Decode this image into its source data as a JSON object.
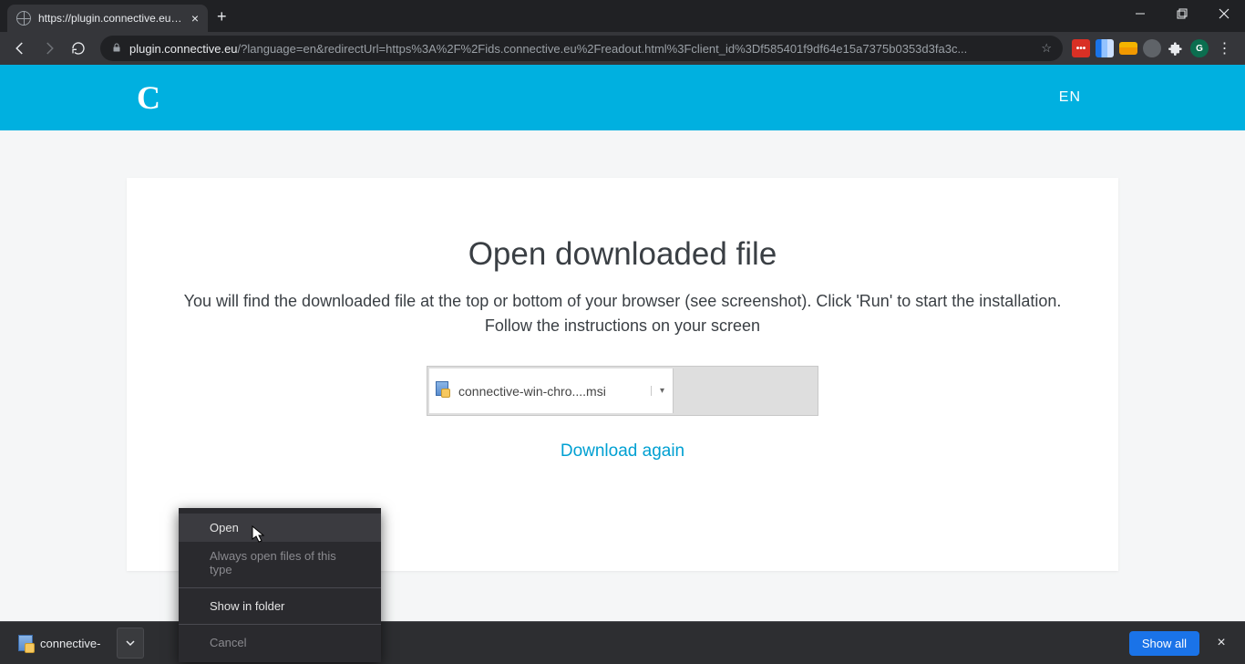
{
  "browser": {
    "tab_title": "https://plugin.connective.eu/?lan",
    "url_domain": "plugin.connective.eu",
    "url_rest": "/?language=en&redirectUrl=https%3A%2F%2Fids.connective.eu%2Freadout.html%3Fclient_id%3Df585401f9df64e15a7375b0353d3fa3c...",
    "profile_letter": "G"
  },
  "site_header": {
    "logo": "C",
    "lang": "EN"
  },
  "content": {
    "heading": "Open downloaded file",
    "line1": "You will find the downloaded file at the top or bottom of your browser (see screenshot). Click 'Run' to start the installation.",
    "line2": "Follow the instructions on your screen",
    "illustration_filename": "connective-win-chro....msi",
    "download_again": "Download again"
  },
  "context_menu": {
    "open": "Open",
    "always": "Always open files of this type",
    "show_folder": "Show in folder",
    "cancel": "Cancel"
  },
  "download_shelf": {
    "filename": "connective-",
    "show_all": "Show all"
  }
}
